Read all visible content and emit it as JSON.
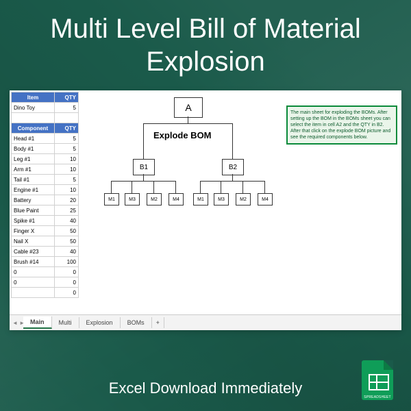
{
  "title": "Multi Level Bill of Material Explosion",
  "footer": "Excel Download Immediately",
  "icon_label": "SPREADSHEET",
  "item_table": {
    "headers": {
      "item": "Item",
      "qty": "QTY"
    },
    "rows": [
      {
        "item": "Dino Toy",
        "qty": "5"
      }
    ]
  },
  "component_table": {
    "headers": {
      "component": "Component",
      "qty": "QTY"
    },
    "rows": [
      {
        "component": "Head #1",
        "qty": "5"
      },
      {
        "component": "Body #1",
        "qty": "5"
      },
      {
        "component": "Leg #1",
        "qty": "10"
      },
      {
        "component": "Arm #1",
        "qty": "10"
      },
      {
        "component": "Tail #1",
        "qty": "5"
      },
      {
        "component": "Engine #1",
        "qty": "10"
      },
      {
        "component": "Battery",
        "qty": "20"
      },
      {
        "component": "Blue Paint",
        "qty": "25"
      },
      {
        "component": "Spike #1",
        "qty": "40"
      },
      {
        "component": "Finger X",
        "qty": "50"
      },
      {
        "component": "Nail X",
        "qty": "50"
      },
      {
        "component": "Cable #23",
        "qty": "40"
      },
      {
        "component": "Brush #14",
        "qty": "100"
      },
      {
        "component": "0",
        "qty": "0"
      },
      {
        "component": "0",
        "qty": "0"
      },
      {
        "component": "",
        "qty": "0"
      }
    ]
  },
  "diagram": {
    "label": "Explode BOM",
    "nodes": {
      "a": "A",
      "b1": "B1",
      "b2": "B2",
      "m1": "M1",
      "m3": "M3",
      "m2": "M2",
      "m4": "M4"
    }
  },
  "info": "The main sheet for exploding the BOMs. After setting up the BOM in the BOMs sheet you can select the item in cell A2 and the QTY in B2. After that click on the explode BOM picture and see the required components below.",
  "tabs": [
    "Main",
    "Multi",
    "Explosion",
    "BOMs"
  ]
}
